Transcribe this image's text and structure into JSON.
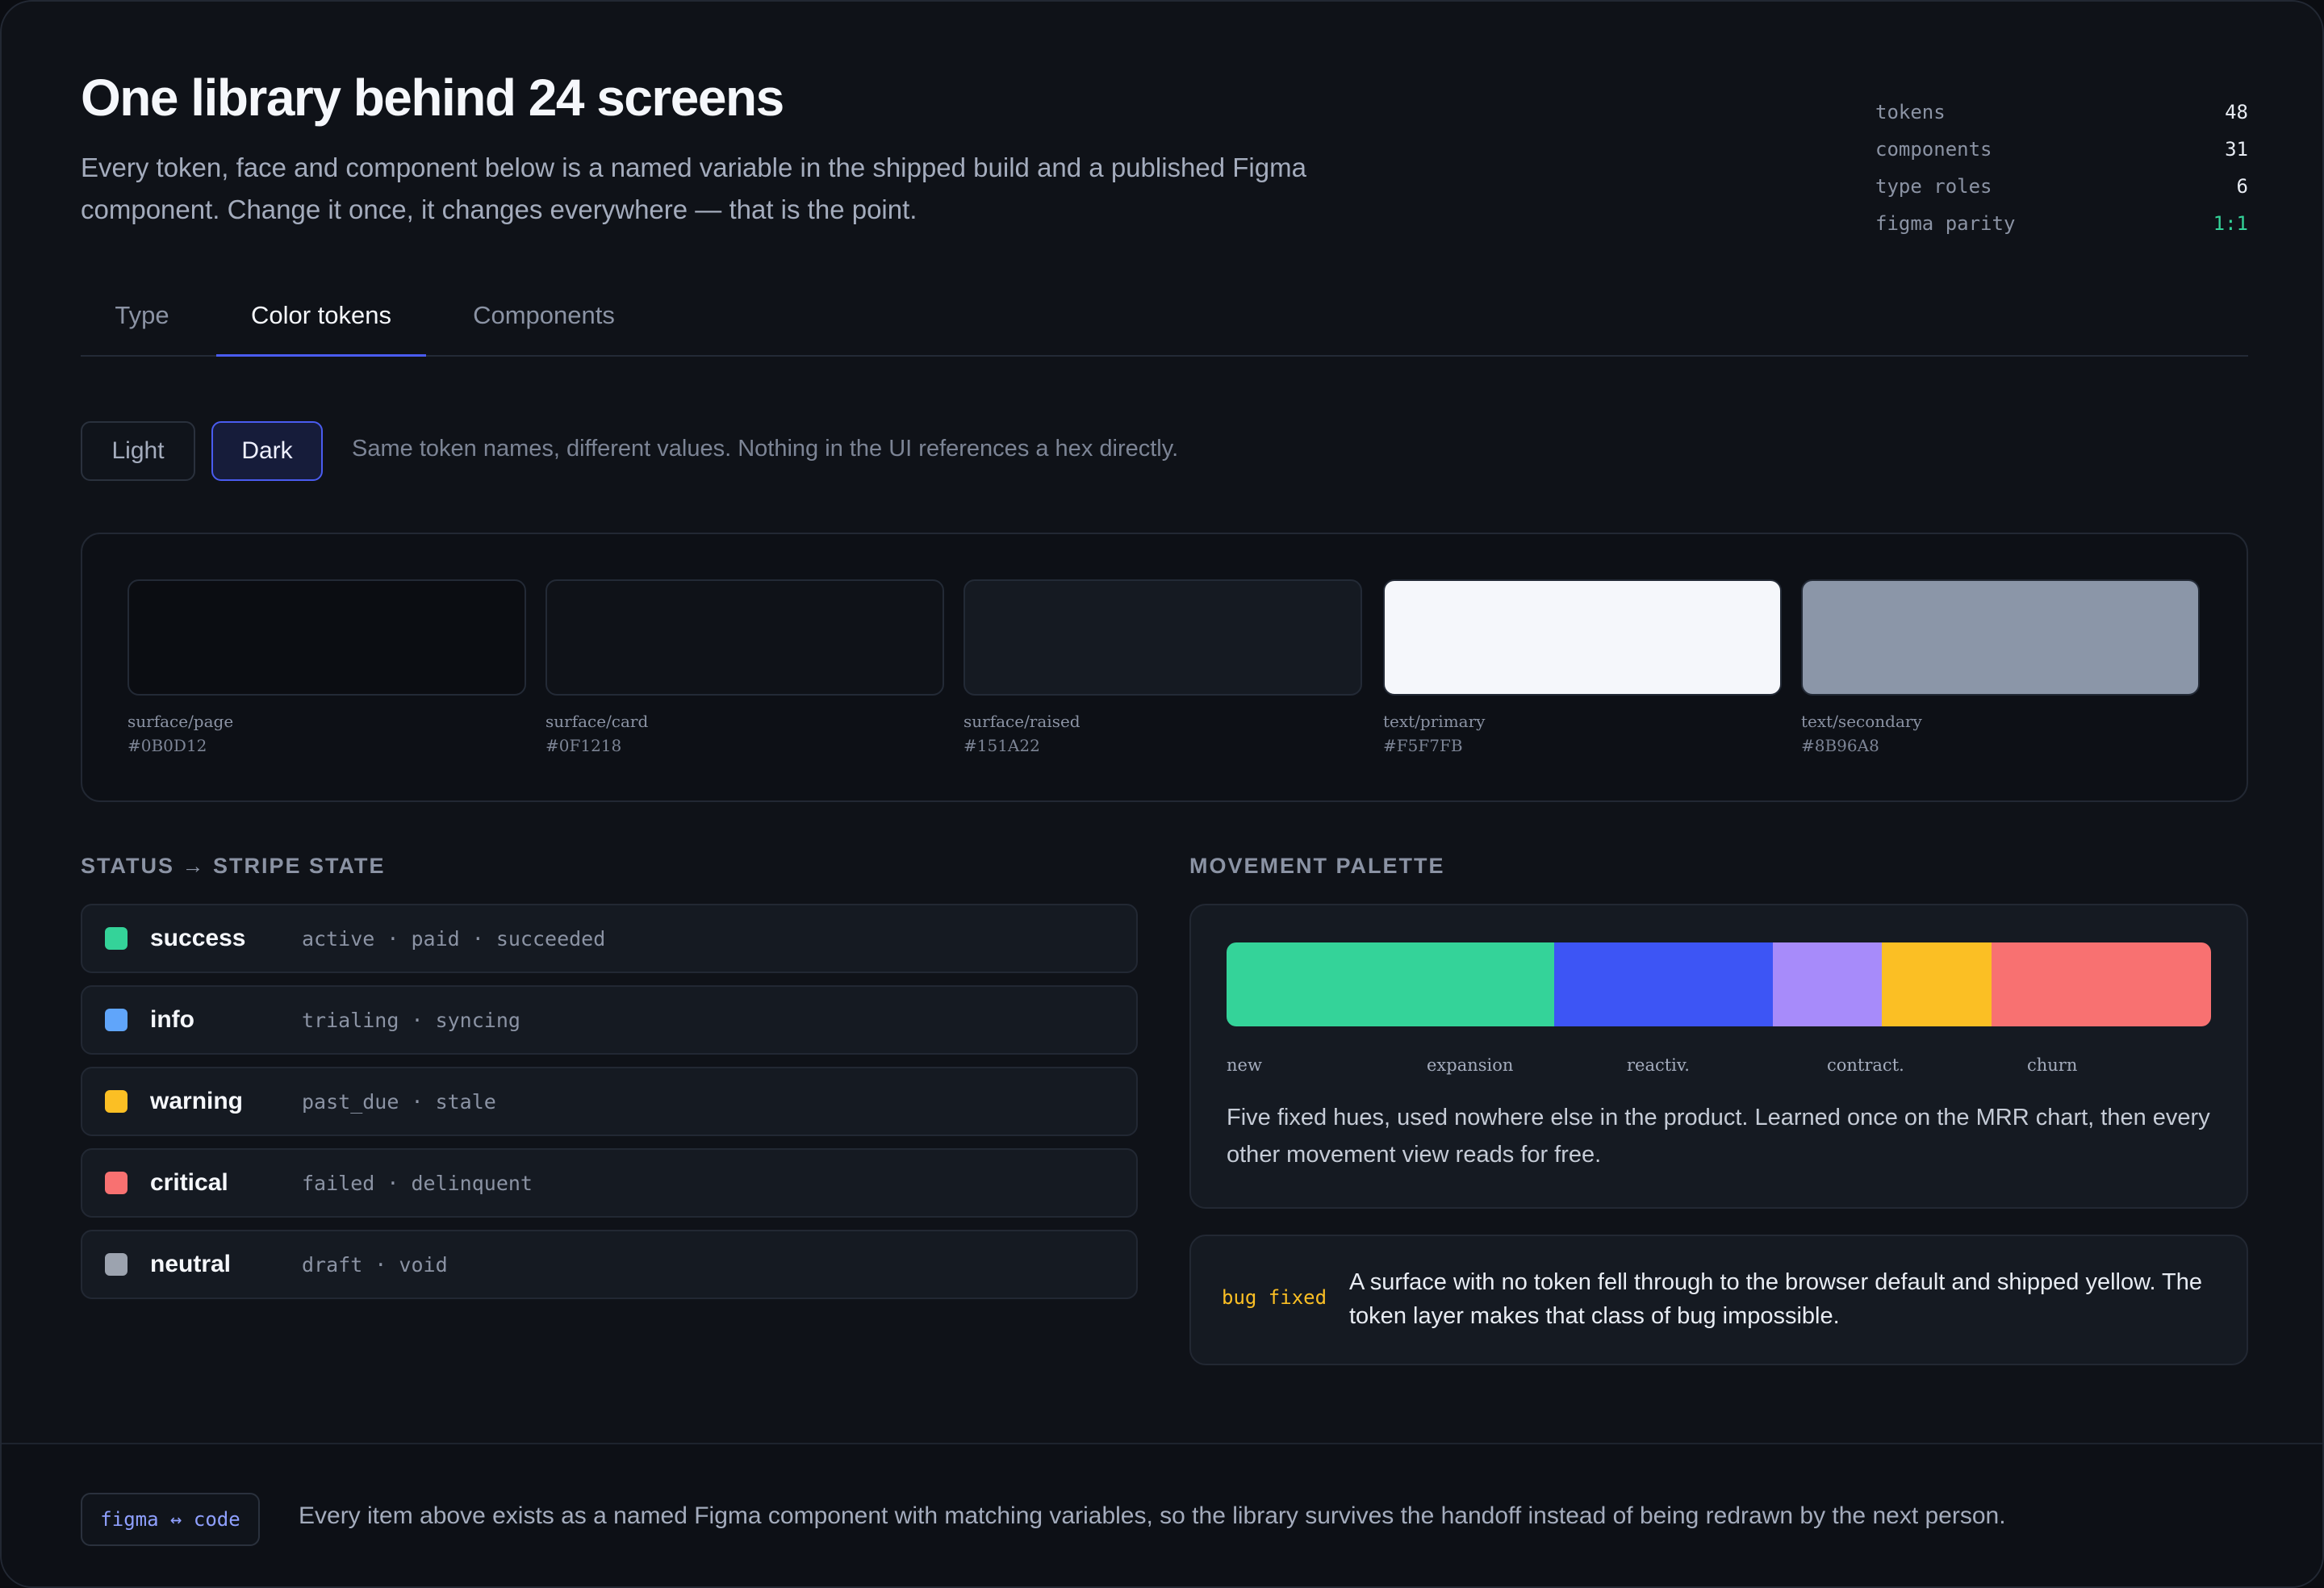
{
  "header": {
    "title": "One library behind 24 screens",
    "lede": "Every token, face and component below is a named variable in the shipped build and a published Figma component. Change it once, it changes everywhere — that is the point."
  },
  "stats": [
    {
      "label": "tokens",
      "value": "48"
    },
    {
      "label": "components",
      "value": "31"
    },
    {
      "label": "type roles",
      "value": "6"
    },
    {
      "label": "figma parity",
      "value": "1:1"
    }
  ],
  "tabs": [
    {
      "label": "Type"
    },
    {
      "label": "Color tokens",
      "active": true
    },
    {
      "label": "Components"
    }
  ],
  "mode": {
    "light_label": "Light",
    "dark_label": "Dark",
    "selected": "Dark",
    "note": "Same token names, different values. Nothing in the UI references a hex directly."
  },
  "swatches": [
    {
      "name": "surface/page",
      "hex": "#0B0D12",
      "color": "#0B0D12"
    },
    {
      "name": "surface/card",
      "hex": "#0F1218",
      "color": "#0F1218"
    },
    {
      "name": "surface/raised",
      "hex": "#151A22",
      "color": "#151A22"
    },
    {
      "name": "text/primary",
      "hex": "#F5F7FB",
      "color": "#F5F7FB"
    },
    {
      "name": "text/secondary",
      "hex": "#8B96A8",
      "color": "#8B96A8"
    }
  ],
  "status_section": {
    "heading": "STATUS → STRIPE STATE",
    "rows": [
      {
        "name": "success",
        "states": "active · paid · succeeded",
        "color": "#34D399"
      },
      {
        "name": "info",
        "states": "trialing · syncing",
        "color": "#60A5FA"
      },
      {
        "name": "warning",
        "states": "past_due · stale",
        "color": "#FBBF24"
      },
      {
        "name": "critical",
        "states": "failed · delinquent",
        "color": "#F87171"
      },
      {
        "name": "neutral",
        "states": "draft · void",
        "color": "#9CA3AF"
      }
    ]
  },
  "movement": {
    "heading": "MOVEMENT PALETTE",
    "segments": [
      {
        "label": "new",
        "color": "#34D399",
        "share": 33.3
      },
      {
        "label": "expansion",
        "color": "#3D55F5",
        "share": 22.2
      },
      {
        "label": "reactiv.",
        "color": "#A78BFA",
        "share": 11.1
      },
      {
        "label": "contract.",
        "color": "#FBBF24",
        "share": 11.1
      },
      {
        "label": "churn",
        "color": "#F87171",
        "share": 22.3
      }
    ],
    "text": "Five fixed hues, used nowhere else in the product. Learned once on the MRR chart, then every other movement view reads for free."
  },
  "bug": {
    "tag": "bug fixed",
    "text": "A surface with no token fell through to the browser default and shipped yellow. The token layer makes that class of bug impossible."
  },
  "footer": {
    "badge": "figma ↔ code",
    "text": "Every item above exists as a named Figma component with matching variables, so the library survives the handoff instead of being redrawn by the next person."
  }
}
